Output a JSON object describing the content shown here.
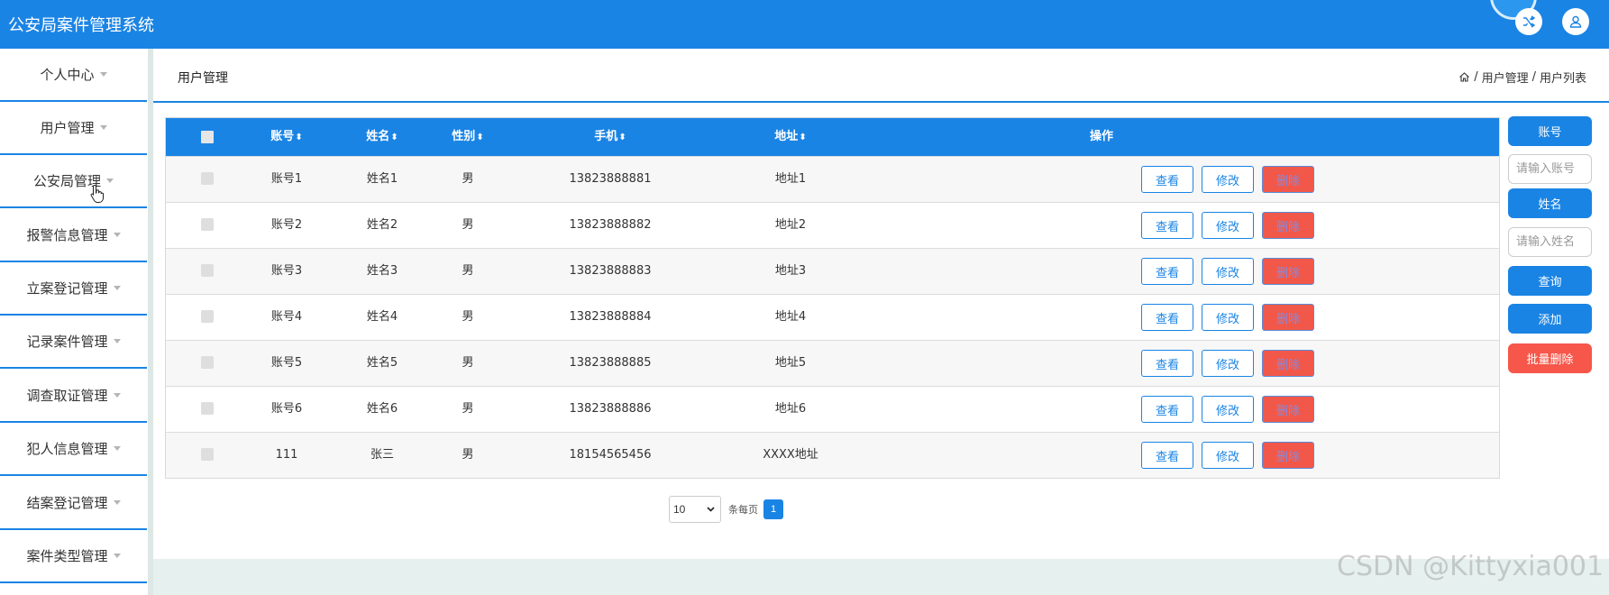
{
  "app": {
    "title": "公安局案件管理系统"
  },
  "header_icons": {
    "shuffle": "shuffle-icon",
    "user": "user-icon"
  },
  "sidebar": {
    "items": [
      {
        "label": "个人中心"
      },
      {
        "label": "用户管理"
      },
      {
        "label": "公安局管理"
      },
      {
        "label": "报警信息管理"
      },
      {
        "label": "立案登记管理"
      },
      {
        "label": "记录案件管理"
      },
      {
        "label": "调查取证管理"
      },
      {
        "label": "犯人信息管理"
      },
      {
        "label": "结案登记管理"
      },
      {
        "label": "案件类型管理"
      }
    ]
  },
  "page": {
    "title": "用户管理",
    "breadcrumb": [
      "用户管理",
      "用户列表"
    ],
    "breadcrumb_sep": "/"
  },
  "table": {
    "columns": [
      "账号",
      "姓名",
      "性别",
      "手机",
      "地址",
      "操作"
    ],
    "sort_icon": "⬍",
    "rows": [
      {
        "account": "账号1",
        "name": "姓名1",
        "gender": "男",
        "phone": "13823888881",
        "address": "地址1"
      },
      {
        "account": "账号2",
        "name": "姓名2",
        "gender": "男",
        "phone": "13823888882",
        "address": "地址2"
      },
      {
        "account": "账号3",
        "name": "姓名3",
        "gender": "男",
        "phone": "13823888883",
        "address": "地址3"
      },
      {
        "account": "账号4",
        "name": "姓名4",
        "gender": "男",
        "phone": "13823888884",
        "address": "地址4"
      },
      {
        "account": "账号5",
        "name": "姓名5",
        "gender": "男",
        "phone": "13823888885",
        "address": "地址5"
      },
      {
        "account": "账号6",
        "name": "姓名6",
        "gender": "男",
        "phone": "13823888886",
        "address": "地址6"
      },
      {
        "account": "111",
        "name": "张三",
        "gender": "男",
        "phone": "18154565456",
        "address": "XXXX地址"
      }
    ],
    "actions": {
      "view": "查看",
      "edit": "修改",
      "delete": "删除"
    }
  },
  "pagination": {
    "page_size": "10",
    "per_page_label": "条每页",
    "current_page": "1"
  },
  "search": {
    "account_label": "账号",
    "account_placeholder": "请输入账号",
    "name_label": "姓名",
    "name_placeholder": "请输入姓名",
    "query_button": "查询",
    "add_button": "添加",
    "batch_delete_button": "批量删除"
  },
  "watermark": "CSDN @Kittyxia001"
}
